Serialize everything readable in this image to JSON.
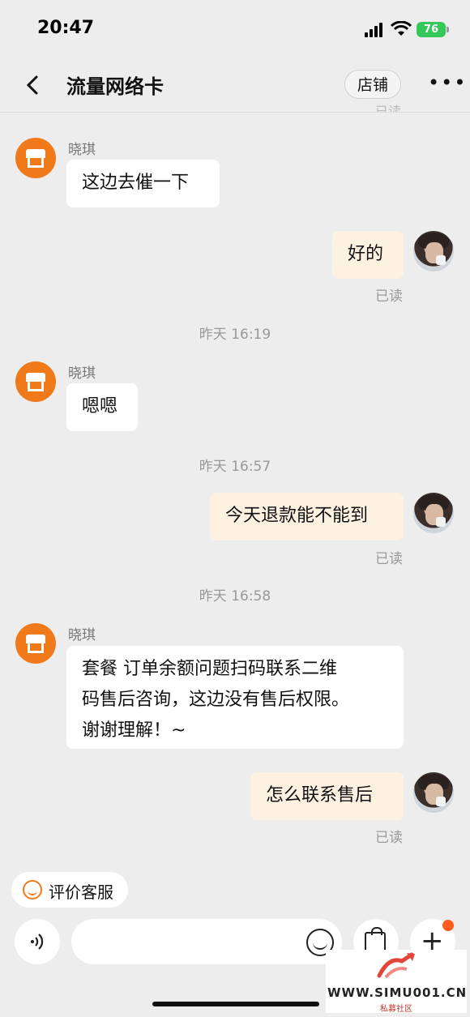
{
  "status_bar": {
    "time": "20:47",
    "battery": "76"
  },
  "header": {
    "title": "流量网络卡",
    "shop_button": "店铺",
    "more": "•••"
  },
  "partial_read": "已读",
  "messages": [
    {
      "side": "left",
      "sender": "晓琪",
      "text": "这边去催一下"
    },
    {
      "side": "right",
      "text": "好的",
      "status": "已读"
    },
    {
      "timestamp": "昨天 16:19"
    },
    {
      "side": "left",
      "sender": "晓琪",
      "text": "嗯嗯"
    },
    {
      "timestamp": "昨天 16:57"
    },
    {
      "side": "right",
      "text": "今天退款能不能到",
      "status": "已读"
    },
    {
      "timestamp": "昨天 16:58"
    },
    {
      "side": "left",
      "sender": "晓琪",
      "lines": [
        "套餐 订单余额问题扫码联系二维",
        "码售后咨询，这边没有售后权限。",
        "谢谢理解！~"
      ]
    },
    {
      "side": "right",
      "text": "怎么联系售后",
      "status": "已读"
    }
  ],
  "bottom": {
    "evaluate_label": "评价客服",
    "input_placeholder": ""
  },
  "watermark": {
    "site": "WWW.SIMU001.CN",
    "sub": "私募社区"
  },
  "colors": {
    "accent": "#f07a1a",
    "bubble_right": "#fdf1e1",
    "bubble_left": "#ffffff",
    "background": "#ededed"
  }
}
